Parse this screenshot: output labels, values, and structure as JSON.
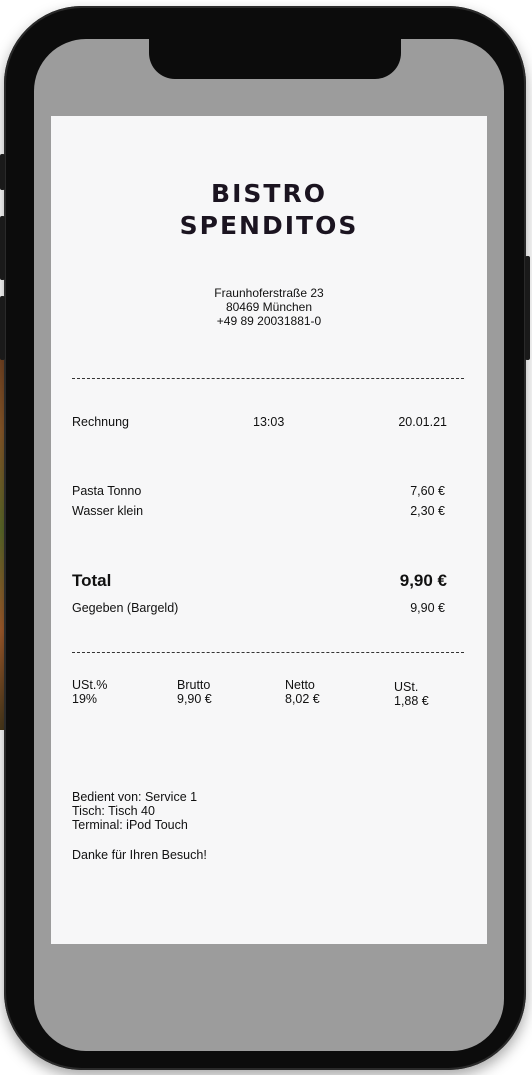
{
  "receipt": {
    "title_line1": "BISTRO",
    "title_line2": "SPENDITOS",
    "address_street": "Fraunhoferstraße 23",
    "address_city": "80469 München",
    "phone": "+49 89 20031881-0",
    "header": {
      "label": "Rechnung",
      "time": "13:03",
      "date": "20.01.21"
    },
    "items": [
      {
        "name": "Pasta Tonno",
        "price": "7,60 €"
      },
      {
        "name": "Wasser klein",
        "price": "2,30 €"
      }
    ],
    "total_label": "Total",
    "total_value": "9,90 €",
    "paid_label": "Gegeben (Bargeld)",
    "paid_value": "9,90 €",
    "tax": {
      "headers": [
        "USt.%",
        "Brutto",
        "Netto",
        "USt."
      ],
      "values": [
        "19%",
        "9,90 €",
        "8,02 €",
        "1,88 €"
      ]
    },
    "served_by": "Bedient von: Service 1",
    "table": "Tisch: Tisch 40",
    "terminal": "Terminal: iPod Touch",
    "thanks": "Danke für Ihren Besuch!"
  }
}
